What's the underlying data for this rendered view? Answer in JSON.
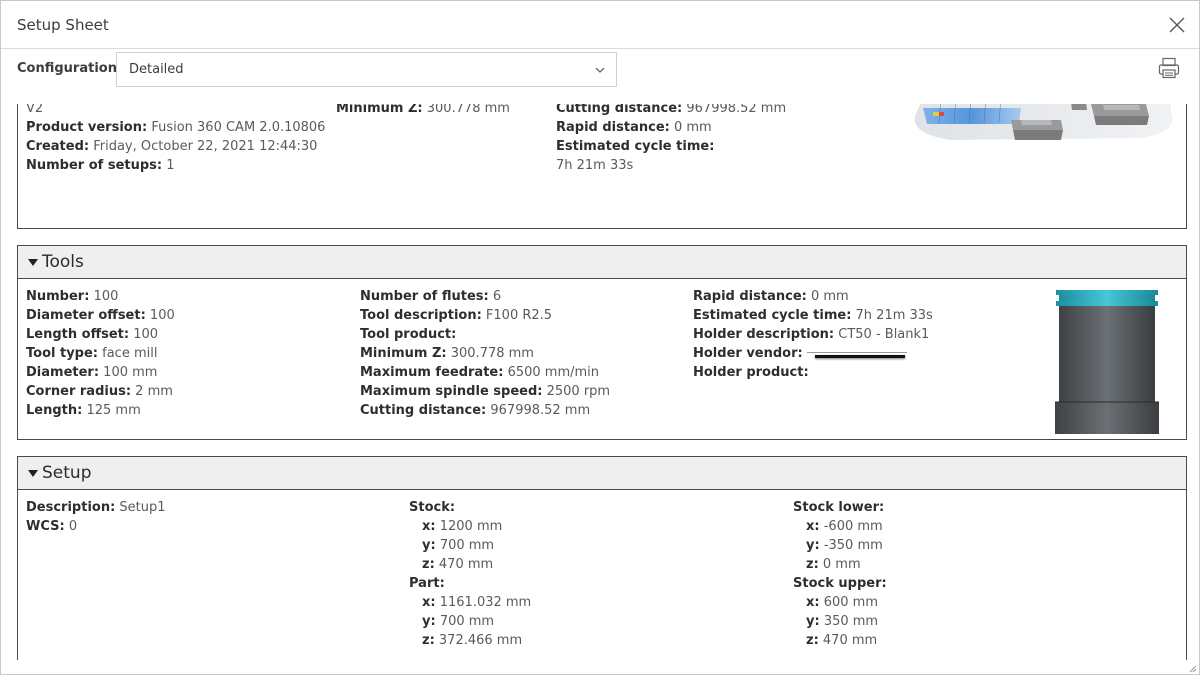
{
  "window": {
    "title": "Setup Sheet"
  },
  "config": {
    "label": "Configuration",
    "selected": "Detailed"
  },
  "summary": {
    "col1": [
      {
        "label": "",
        "value": "V2"
      },
      {
        "label": "Product version:",
        "value": "Fusion 360 CAM 2.0.10806"
      },
      {
        "label": "Created:",
        "value": "Friday, October 22, 2021 12:44:30"
      },
      {
        "label": "Number of setups:",
        "value": "1"
      }
    ],
    "col2": [
      {
        "label": "Minimum Z:",
        "value": "300.778 mm"
      }
    ],
    "col3": [
      {
        "label": "Cutting distance:",
        "value": "967998.52 mm"
      },
      {
        "label": "Rapid distance:",
        "value": "0 mm"
      },
      {
        "label": "Estimated cycle time:",
        "value": ""
      },
      {
        "label": "",
        "value": "7h 21m 33s"
      }
    ]
  },
  "tools": {
    "heading": "Tools",
    "col1": [
      {
        "label": "Number:",
        "value": "100"
      },
      {
        "label": "Diameter offset:",
        "value": "100"
      },
      {
        "label": "Length offset:",
        "value": "100"
      },
      {
        "label": "Tool type:",
        "value": "face mill"
      },
      {
        "label": "Diameter:",
        "value": "100 mm"
      },
      {
        "label": "Corner radius:",
        "value": "2 mm"
      },
      {
        "label": "Length:",
        "value": "125 mm"
      }
    ],
    "col2": [
      {
        "label": "Number of flutes:",
        "value": "6"
      },
      {
        "label": "Tool description:",
        "value": "F100 R2.5"
      },
      {
        "label": "Tool product:",
        "value": ""
      },
      {
        "label": "Minimum Z:",
        "value": "300.778 mm"
      },
      {
        "label": "Maximum feedrate:",
        "value": "6500 mm/min"
      },
      {
        "label": "Maximum spindle speed:",
        "value": "2500 rpm"
      },
      {
        "label": "Cutting distance:",
        "value": "967998.52 mm"
      }
    ],
    "col3": [
      {
        "label": "Rapid distance:",
        "value": "0 mm"
      },
      {
        "label": "Estimated cycle time:",
        "value": "7h 21m 33s"
      },
      {
        "label": "Holder description:",
        "value": "CT50 - Blank1"
      },
      {
        "label": "Holder vendor:",
        "value": ""
      },
      {
        "label": "Holder product:",
        "value": ""
      }
    ]
  },
  "setup": {
    "heading": "Setup",
    "col1": [
      {
        "label": "Description:",
        "value": "Setup1"
      },
      {
        "label": "WCS:",
        "value": "0"
      }
    ],
    "stock": {
      "label": "Stock:",
      "x": "1200 mm",
      "y": "700 mm",
      "z": "470 mm"
    },
    "part": {
      "label": "Part:",
      "x": "1161.032 mm",
      "y": "700 mm",
      "z": "372.466 mm"
    },
    "stock_lower": {
      "label": "Stock lower:",
      "x": "-600 mm",
      "y": "-350 mm",
      "z": "0 mm"
    },
    "stock_upper": {
      "label": "Stock upper:",
      "x": "600 mm",
      "y": "350 mm",
      "z": "470 mm"
    },
    "axis_x": "x:",
    "axis_y": "y:",
    "axis_z": "z:"
  }
}
